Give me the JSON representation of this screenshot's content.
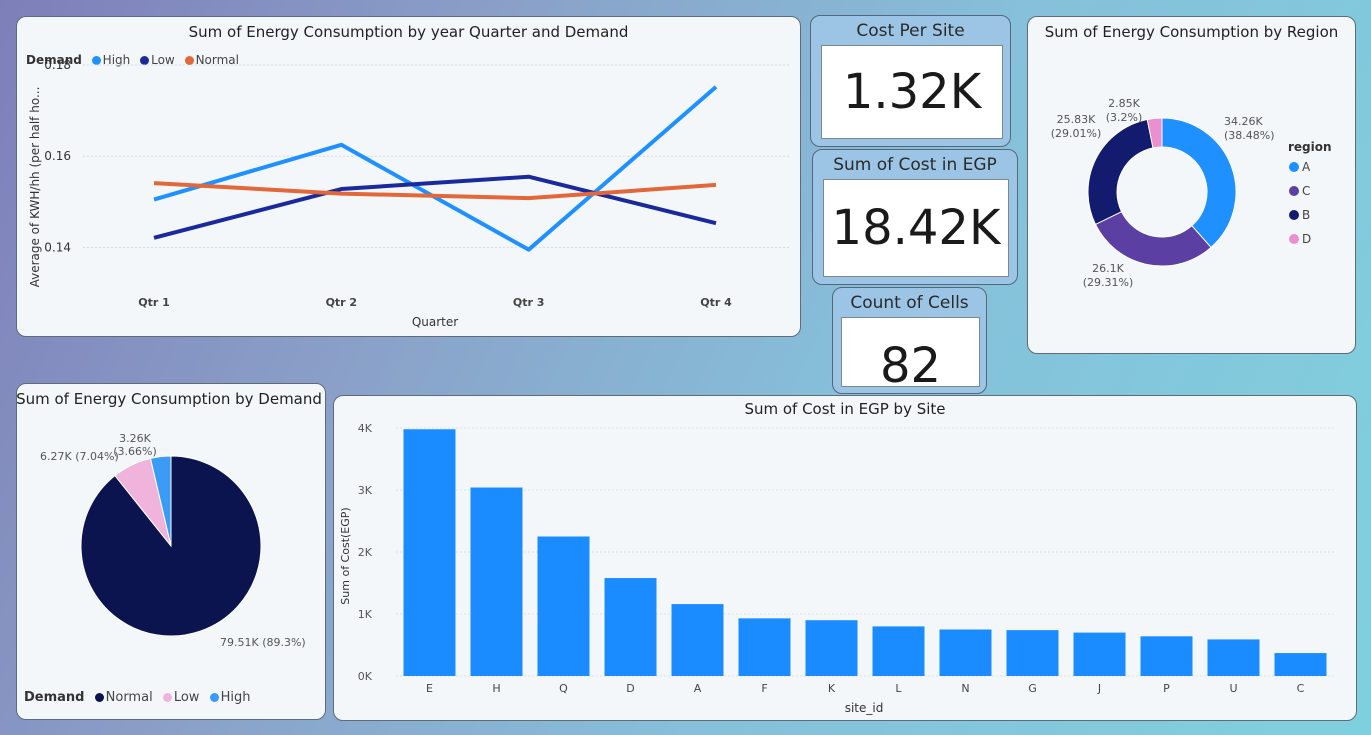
{
  "line_card": {
    "title": "Sum of Energy Consumption by year Quarter and Demand"
  },
  "donut_card": {
    "title": "Sum of Energy Consumption by Region"
  },
  "pie_card": {
    "title": "Sum of Energy Consumption by Demand"
  },
  "bar_card": {
    "title": "Sum of Cost in EGP by Site"
  },
  "kpis": {
    "cost_per_site": {
      "title": "Cost Per Site",
      "value": "1.32K"
    },
    "sum_cost": {
      "title": "Sum of Cost in EGP",
      "value": "18.42K"
    },
    "count_cells": {
      "title": "Count of Cells",
      "value": "82"
    }
  },
  "chart_data": [
    {
      "type": "line",
      "title": "Sum of Energy Consumption by year Quarter and Demand",
      "xlabel": "Quarter",
      "ylabel": "Average of KWH/hh (per half ho...",
      "categories": [
        "Qtr 1",
        "Qtr 2",
        "Qtr 3",
        "Qtr 4"
      ],
      "ylim": [
        0.13,
        0.18
      ],
      "yticks": [
        0.14,
        0.16,
        0.18
      ],
      "legend_title": "Demand",
      "series": [
        {
          "name": "High",
          "color": "#1e90ff",
          "values": [
            0.1505,
            0.1625,
            0.1395,
            0.1752
          ]
        },
        {
          "name": "Low",
          "color": "#1a2a9c",
          "values": [
            0.1421,
            0.1528,
            0.1555,
            0.1453
          ]
        },
        {
          "name": "Normal",
          "color": "#e2683a",
          "values": [
            0.1541,
            0.1518,
            0.1508,
            0.1537
          ]
        }
      ]
    },
    {
      "type": "pie",
      "subtype": "donut",
      "title": "Sum of Energy Consumption by Region",
      "legend_title": "region",
      "slices": [
        {
          "name": "A",
          "value": 34.26,
          "label": "34.26K",
          "pct_label": "(38.48%)",
          "color": "#1e90ff"
        },
        {
          "name": "C",
          "value": 26.1,
          "label": "26.1K",
          "pct_label": "(29.31%)",
          "color": "#5b3fa3"
        },
        {
          "name": "B",
          "value": 25.83,
          "label": "25.83K",
          "pct_label": "(29.01%)",
          "color": "#131b6e"
        },
        {
          "name": "D",
          "value": 2.85,
          "label": "2.85K",
          "pct_label": "(3.2%)",
          "color": "#ea8fd0"
        }
      ]
    },
    {
      "type": "pie",
      "title": "Sum of Energy Consumption by Demand",
      "legend_title": "Demand",
      "slices": [
        {
          "name": "Normal",
          "value": 79.51,
          "label": "79.51K (89.3%)",
          "color": "#0c1450"
        },
        {
          "name": "Low",
          "value": 6.27,
          "label": "6.27K (7.04%)",
          "color": "#f0b3dc"
        },
        {
          "name": "High",
          "value": 3.26,
          "label": "3.26K",
          "pct_label": "(3.66%)",
          "color": "#3b9cf5"
        }
      ]
    },
    {
      "type": "bar",
      "title": "Sum of Cost in EGP by Site",
      "xlabel": "site_id",
      "ylabel": "Sum of Cost(EGP)",
      "categories": [
        "E",
        "H",
        "Q",
        "D",
        "A",
        "F",
        "K",
        "L",
        "N",
        "G",
        "J",
        "P",
        "U",
        "C"
      ],
      "values": [
        3980,
        3040,
        2250,
        1580,
        1160,
        930,
        900,
        800,
        750,
        740,
        700,
        640,
        590,
        370
      ],
      "ylim": [
        0,
        4000
      ],
      "yticks": [
        "0K",
        "1K",
        "2K",
        "3K",
        "4K"
      ],
      "color": "#1a8cff"
    }
  ]
}
